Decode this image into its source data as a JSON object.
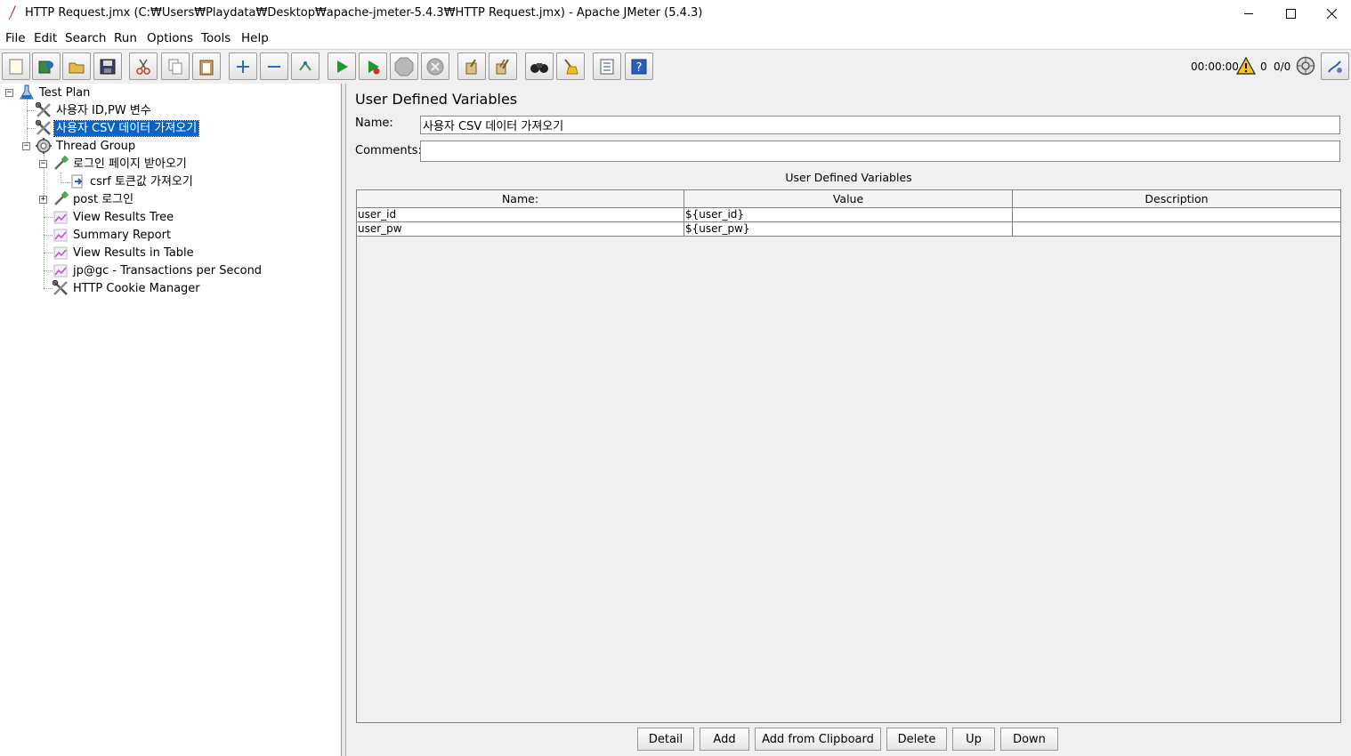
{
  "window": {
    "title": "HTTP Request.jmx (C:₩Users₩Playdata₩Desktop₩apache-jmeter-5.4.3₩HTTP Request.jmx) - Apache JMeter (5.4.3)"
  },
  "menu": [
    "File",
    "Edit",
    "Search",
    "Run",
    "Options",
    "Tools",
    "Help"
  ],
  "toolbar": {
    "buttons": [
      "new-icon",
      "templates-icon",
      "open-icon",
      "save-icon",
      "cut-icon",
      "copy-icon",
      "paste-icon",
      "expand-icon",
      "collapse-icon",
      "toggle-icon",
      "start-icon",
      "start-no-pause-icon",
      "stop-icon",
      "shutdown-icon",
      "clear-icon",
      "clear-all-icon",
      "search-icon",
      "reset-search-icon",
      "function-helper-icon",
      "help-icon"
    ],
    "elapsed": "00:00:00",
    "warnings": "0",
    "threads": "0/0"
  },
  "tree": [
    {
      "label": "Test Plan",
      "icon": "test-plan-icon"
    },
    {
      "label": "사용자 ID,PW 변수",
      "icon": "config-icon"
    },
    {
      "label": "사용자 CSV 데이터 가져오기",
      "icon": "config-icon",
      "selected": true
    },
    {
      "label": "Thread Group",
      "icon": "thread-group-icon"
    },
    {
      "label": "로그인 페이지 받아오기",
      "icon": "sampler-icon"
    },
    {
      "label": "csrf 토큰값 가져오기",
      "icon": "extractor-icon"
    },
    {
      "label": "post 로그인",
      "icon": "sampler-icon"
    },
    {
      "label": "View Results Tree",
      "icon": "listener-icon"
    },
    {
      "label": "Summary Report",
      "icon": "listener-icon"
    },
    {
      "label": "View Results in Table",
      "icon": "listener-icon"
    },
    {
      "label": "jp@gc - Transactions per Second",
      "icon": "listener-icon"
    },
    {
      "label": "HTTP Cookie Manager",
      "icon": "config-icon"
    }
  ],
  "panel": {
    "title": "User Defined Variables",
    "name_label": "Name:",
    "name_value": "사용자 CSV 데이터 가져오기",
    "comments_label": "Comments:",
    "comments_value": "",
    "table_caption": "User Defined Variables",
    "columns": [
      "Name:",
      "Value",
      "Description"
    ],
    "rows": [
      [
        "user_id",
        "${user_id}",
        ""
      ],
      [
        "user_pw",
        "${user_pw}",
        ""
      ]
    ],
    "buttons": [
      "Detail",
      "Add",
      "Add from Clipboard",
      "Delete",
      "Up",
      "Down"
    ]
  }
}
